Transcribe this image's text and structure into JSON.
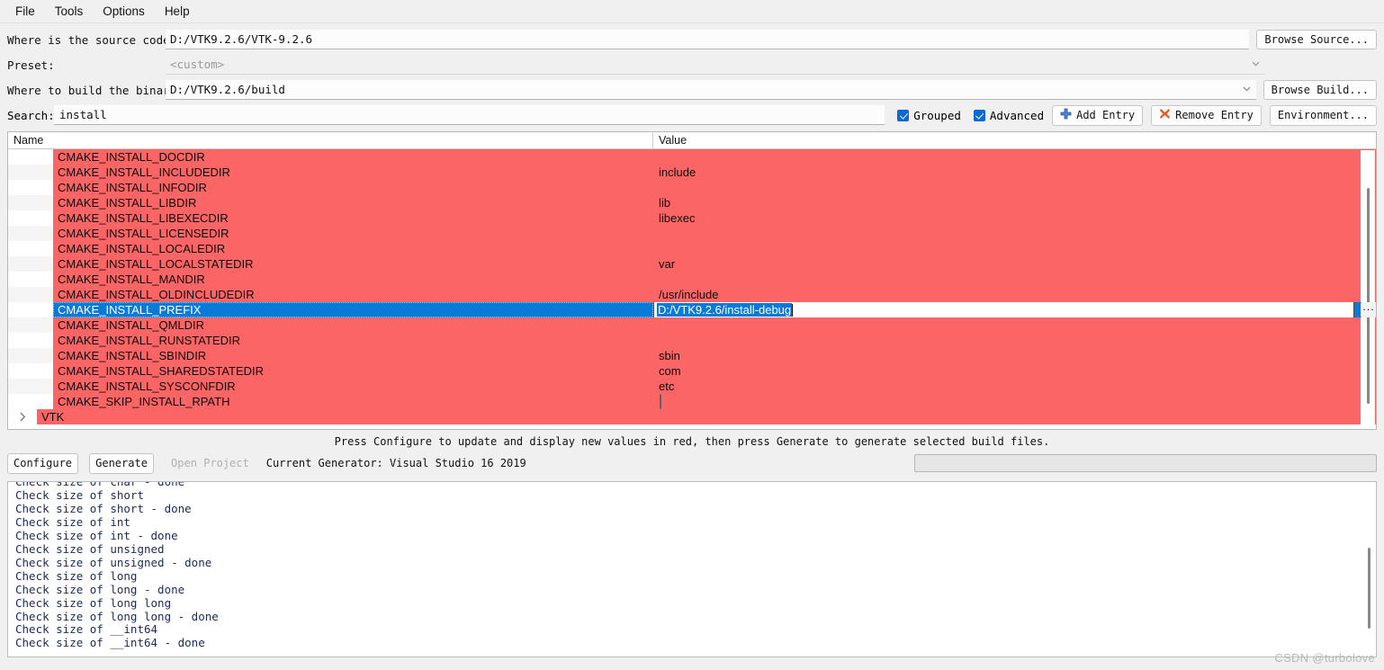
{
  "menu": {
    "items": [
      {
        "label": "File"
      },
      {
        "label": "Tools"
      },
      {
        "label": "Options"
      },
      {
        "label": "Help"
      }
    ]
  },
  "form": {
    "source_label": "Where is the source code:",
    "source_value": "D:/VTK9.2.6/VTK-9.2.6",
    "browse_source_label": "Browse Source...",
    "preset_label": "Preset:",
    "preset_value": "<custom>",
    "build_label": "Where to build the binaries:",
    "build_value": "D:/VTK9.2.6/build",
    "browse_build_label": "Browse Build..."
  },
  "search": {
    "label": "Search:",
    "value": "install",
    "grouped_label": "Grouped",
    "advanced_label": "Advanced",
    "add_entry_label": "Add Entry",
    "remove_entry_label": "Remove Entry",
    "environment_label": "Environment..."
  },
  "table": {
    "col_name": "Name",
    "col_value": "Value",
    "rows": [
      {
        "name": "CMAKE_INSTALL_DOCDIR",
        "value": ""
      },
      {
        "name": "CMAKE_INSTALL_INCLUDEDIR",
        "value": "include"
      },
      {
        "name": "CMAKE_INSTALL_INFODIR",
        "value": ""
      },
      {
        "name": "CMAKE_INSTALL_LIBDIR",
        "value": "lib"
      },
      {
        "name": "CMAKE_INSTALL_LIBEXECDIR",
        "value": "libexec"
      },
      {
        "name": "CMAKE_INSTALL_LICENSEDIR",
        "value": ""
      },
      {
        "name": "CMAKE_INSTALL_LOCALEDIR",
        "value": ""
      },
      {
        "name": "CMAKE_INSTALL_LOCALSTATEDIR",
        "value": "var"
      },
      {
        "name": "CMAKE_INSTALL_MANDIR",
        "value": ""
      },
      {
        "name": "CMAKE_INSTALL_OLDINCLUDEDIR",
        "value": "/usr/include"
      },
      {
        "name": "CMAKE_INSTALL_PREFIX",
        "value": "D:/VTK9.2.6/install-debug"
      },
      {
        "name": "CMAKE_INSTALL_QMLDIR",
        "value": ""
      },
      {
        "name": "CMAKE_INSTALL_RUNSTATEDIR",
        "value": ""
      },
      {
        "name": "CMAKE_INSTALL_SBINDIR",
        "value": "sbin"
      },
      {
        "name": "CMAKE_INSTALL_SHAREDSTATEDIR",
        "value": "com"
      },
      {
        "name": "CMAKE_INSTALL_SYSCONFDIR",
        "value": "etc"
      },
      {
        "name": "CMAKE_SKIP_INSTALL_RPATH",
        "value": ""
      }
    ],
    "selected_index": 10,
    "editing_value": "D:/VTK9.2.6/install-debug",
    "browse_dots_label": "···",
    "group_row": {
      "name": "VTK",
      "expander": "›"
    }
  },
  "hint": "Press Configure to update and display new values in red, then press Generate to generate selected build files.",
  "actions": {
    "configure_label": "Configure",
    "generate_label": "Generate",
    "open_project_label": "Open Project",
    "generator_label": "Current Generator: Visual Studio 16 2019"
  },
  "log": {
    "text": "Check size of char - done\nCheck size of short\nCheck size of short - done\nCheck size of int\nCheck size of int - done\nCheck size of unsigned\nCheck size of unsigned - done\nCheck size of long\nCheck size of long - done\nCheck size of long long\nCheck size of long long - done\nCheck size of __int64\nCheck size of __int64 - done"
  },
  "watermark": "CSDN @turbolove",
  "colors": {
    "modified_row": "#fc6565",
    "selection": "#0a7ad8",
    "accent_check": "#0a68d8",
    "log_text": "#1b2a5e"
  }
}
